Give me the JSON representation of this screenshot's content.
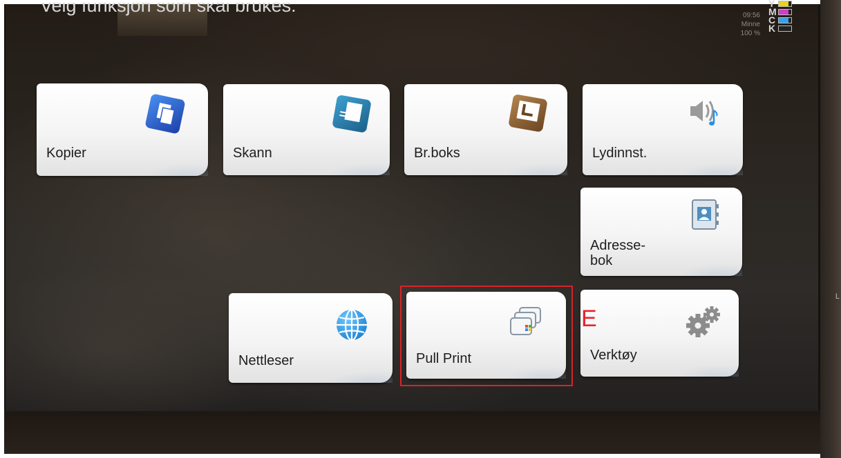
{
  "header": {
    "prompt": "Velg funksjon som skal brukes."
  },
  "status": {
    "time": "09:56",
    "memory_label": "Minne",
    "memory_value": "100 %"
  },
  "toner": [
    {
      "letter": "Y",
      "color": "#e8d21a",
      "level": 0.8
    },
    {
      "letter": "M",
      "color": "#d23cc8",
      "level": 0.8
    },
    {
      "letter": "C",
      "color": "#3aa0e8",
      "level": 0.8
    },
    {
      "letter": "K",
      "color": "#222222",
      "level": 0.05
    }
  ],
  "tiles": [
    {
      "id": "kopier",
      "label": "Kopier",
      "icon": "copy-icon"
    },
    {
      "id": "skann",
      "label": "Skann",
      "icon": "scan-icon"
    },
    {
      "id": "brboks",
      "label": "Br.boks",
      "icon": "document-box-icon"
    },
    {
      "id": "lyd",
      "label": "Lydinnst.",
      "icon": "speaker-icon"
    },
    {
      "id": "adressebok",
      "label_line1": "Adresse-",
      "label_line2": "bok",
      "icon": "address-book-icon"
    },
    {
      "id": "nettleser",
      "label": "Nettleser",
      "icon": "globe-icon"
    },
    {
      "id": "pullprint",
      "label": "Pull Print",
      "icon": "pull-print-icon"
    },
    {
      "id": "verktoy",
      "label": "Verktøy",
      "icon": "gears-icon"
    }
  ],
  "annotation": {
    "letter": "E",
    "color": "#e8232a"
  },
  "edge_text": "L"
}
